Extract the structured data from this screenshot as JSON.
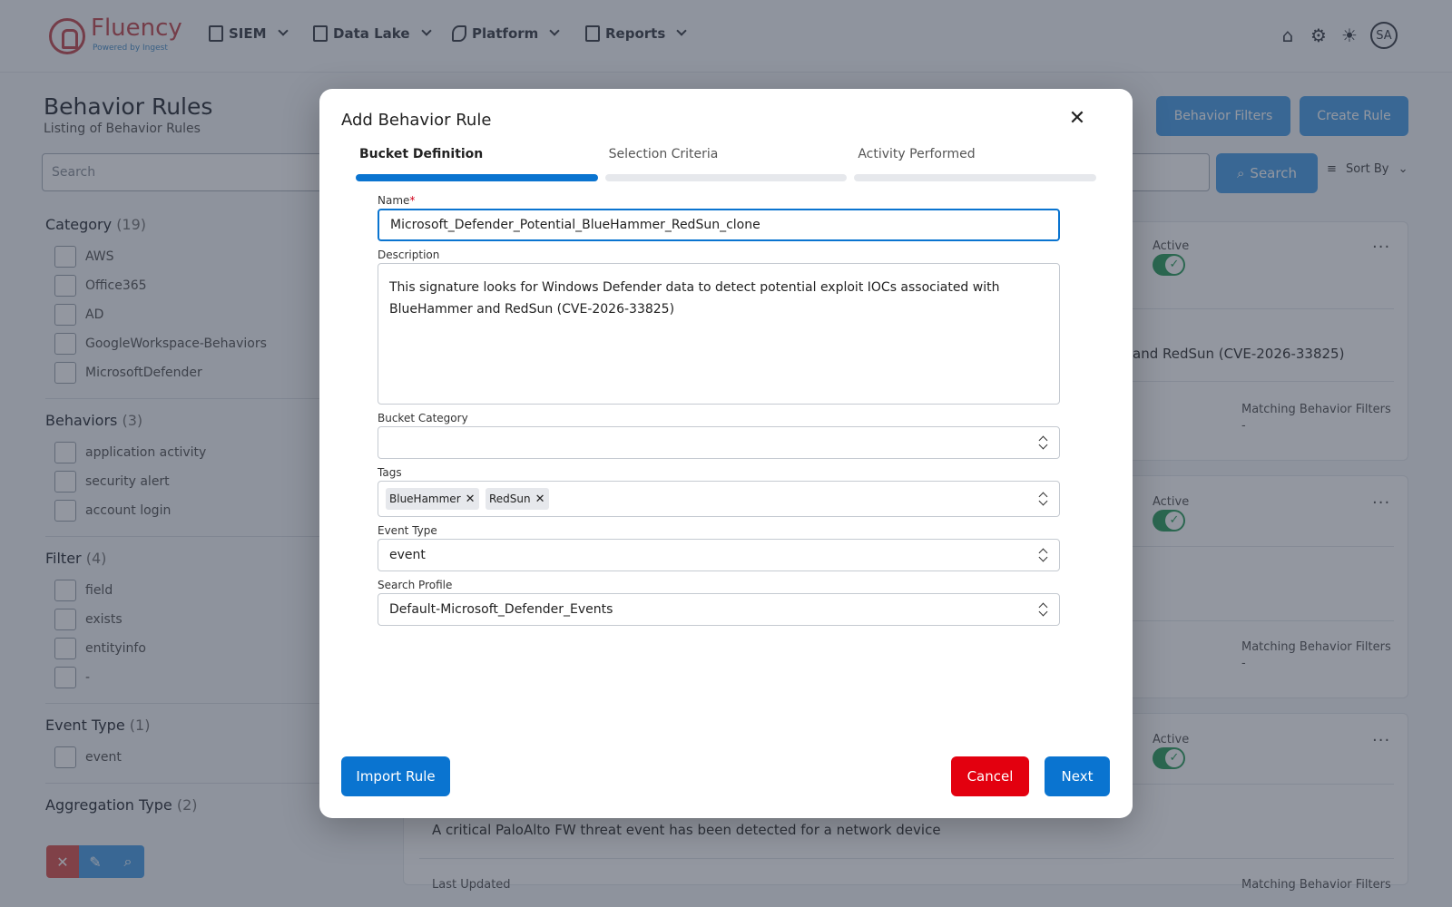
{
  "nav": {
    "logo_text": "Fluency",
    "logo_sub": "Powered by Ingest",
    "menus": [
      {
        "label": "SIEM"
      },
      {
        "label": "Data Lake"
      },
      {
        "label": "Platform"
      },
      {
        "label": "Reports"
      }
    ],
    "avatar": "SA",
    "icons": [
      "home-icon",
      "settings-icon",
      "theme-sun-icon"
    ]
  },
  "page": {
    "title": "Behavior Rules",
    "subtitle": "Listing of Behavior Rules",
    "behavior_filters_label": "Behavior Filters",
    "create_rule_label": "Create Rule",
    "search_placeholder": "Search",
    "search_button": "Search",
    "sort_by": "Sort By"
  },
  "sidebar": {
    "category": {
      "title": "Category",
      "count": "(19)",
      "items": [
        "AWS",
        "Office365",
        "AD",
        "GoogleWorkspace-Behaviors",
        "MicrosoftDefender"
      ]
    },
    "behaviors": {
      "title": "Behaviors",
      "count": "(3)",
      "items": [
        "application activity",
        "security alert",
        "account login"
      ]
    },
    "filter": {
      "title": "Filter",
      "count": "(4)",
      "items": [
        "field",
        "exists",
        "entityinfo",
        "-"
      ]
    },
    "event_type": {
      "title": "Event Type",
      "count": "(1)",
      "items": [
        "event"
      ]
    },
    "aggregation_type": {
      "title": "Aggregation Type",
      "count": "(2)"
    }
  },
  "cards": {
    "active_label": "Active",
    "matching_label": "Matching Behavior Filters",
    "matching_value": "-",
    "card1_desc_tail": "and RedSun (CVE-2026-33825)",
    "card3_desc": "A critical PaloAlto FW threat event has been detected for a network device",
    "card3_last_updated": "Last Updated"
  },
  "modal": {
    "title": "Add Behavior Rule",
    "steps": [
      "Bucket Definition",
      "Selection Criteria",
      "Activity Performed"
    ],
    "active_step": 0,
    "name_label": "Name",
    "name_required": "*",
    "name_value": "Microsoft_Defender_Potential_BlueHammer_RedSun_clone",
    "description_label": "Description",
    "description_value": "This signature looks for Windows Defender data to detect potential exploit IOCs associated with BlueHammer and RedSun (CVE-2026-33825)",
    "bucket_category_label": "Bucket Category",
    "bucket_category_value": "",
    "tags_label": "Tags",
    "tags": [
      "BlueHammer",
      "RedSun"
    ],
    "event_type_label": "Event Type",
    "event_type_value": "event",
    "search_profile_label": "Search Profile",
    "search_profile_value": "Default-Microsoft_Defender_Events",
    "import_rule_label": "Import Rule",
    "cancel_label": "Cancel",
    "next_label": "Next"
  },
  "colors": {
    "primary": "#0a74d0",
    "danger": "#e3000f",
    "active_green": "#2f9e5e",
    "brand": "#c24b50"
  }
}
